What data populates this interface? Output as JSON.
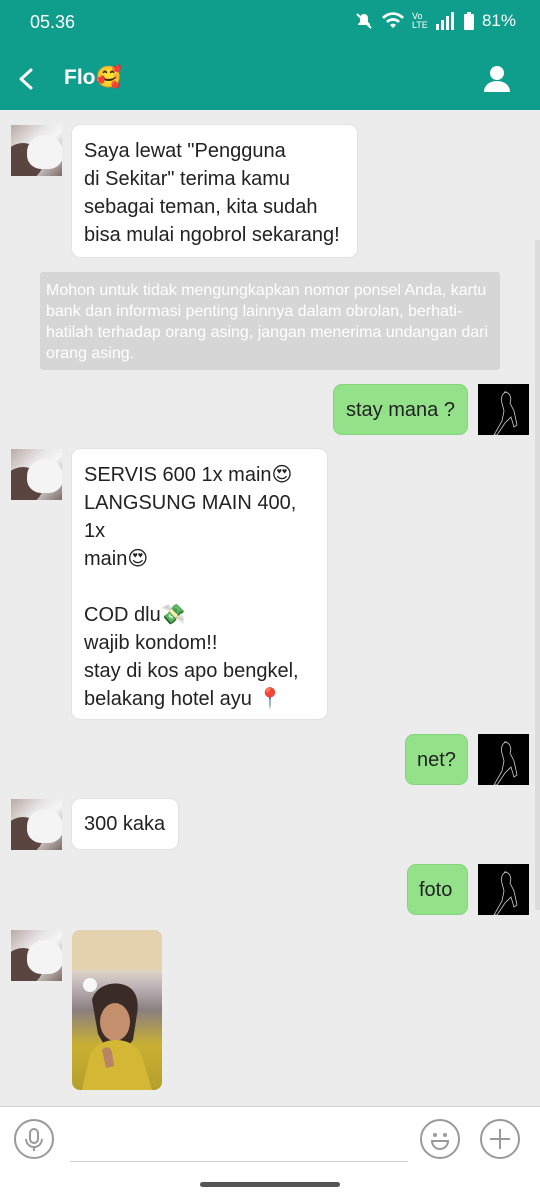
{
  "status": {
    "time": "05.36",
    "battery": "81%",
    "network": "Vo LTE"
  },
  "header": {
    "title": "Flo🥰"
  },
  "messages": [
    {
      "from": "other",
      "text": "Saya lewat \"Pengguna\ndi Sekitar\" terima kamu\nsebagai teman, kita sudah\nbisa mulai ngobrol sekarang!"
    },
    {
      "from": "system",
      "text": "Mohon untuk tidak  mengungkapkan nomor ponsel Anda, kartu bank dan informasi penting lainnya dalam obrolan, berhati-hatilah terhadap orang asing, jangan menerima undangan dari orang asing."
    },
    {
      "from": "me",
      "text": "stay mana ?"
    },
    {
      "from": "other",
      "text": "SERVIS 600 1x main😍\nLANGSUNG MAIN 400, 1x\nmain😍\n\nCOD dlu💸\nwajib kondom!!\nstay di kos apo bengkel,\nbelakang hotel ayu 📍"
    },
    {
      "from": "me",
      "text": "net?"
    },
    {
      "from": "other",
      "text": "300 kaka"
    },
    {
      "from": "me",
      "text": "foto"
    },
    {
      "from": "other",
      "type": "image"
    }
  ],
  "input": {
    "placeholder": ""
  },
  "colors": {
    "header": "#0f9e8c",
    "outgoing_bubble": "#93e28a",
    "incoming_bubble": "#ffffff",
    "background": "#ececec"
  },
  "icons": [
    "back-arrow-icon",
    "profile-icon",
    "microphone-icon",
    "emoji-icon",
    "plus-icon"
  ]
}
